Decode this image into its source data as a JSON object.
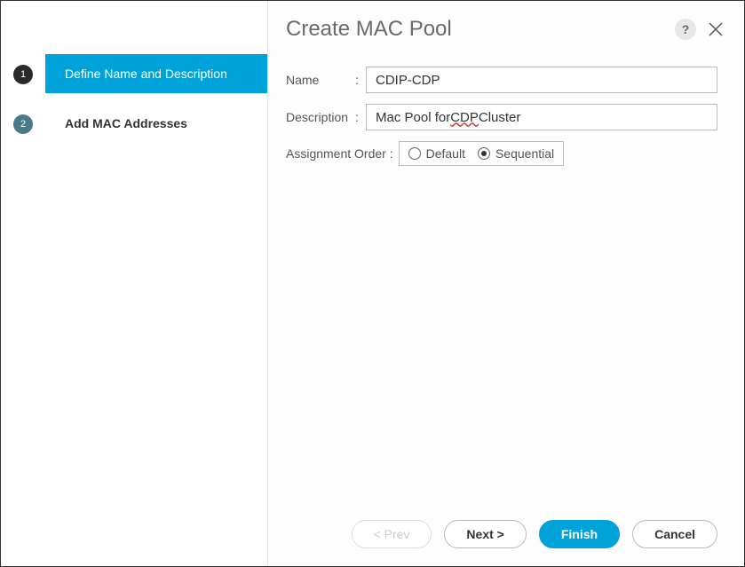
{
  "title": "Create MAC Pool",
  "sidebar": {
    "steps": [
      {
        "num": "1",
        "label": "Define Name and Description",
        "selected": true
      },
      {
        "num": "2",
        "label": "Add MAC Addresses",
        "selected": false
      }
    ]
  },
  "form": {
    "name_label": "Name",
    "name_value": "CDIP-CDP",
    "desc_label": "Description",
    "desc_value": "Mac Pool for CDP Cluster",
    "assign_label": "Assignment Order :",
    "options": {
      "default": "Default",
      "sequential": "Sequential"
    },
    "selected_option": "sequential"
  },
  "buttons": {
    "prev": "< Prev",
    "next": "Next >",
    "finish": "Finish",
    "cancel": "Cancel"
  },
  "help": "?"
}
